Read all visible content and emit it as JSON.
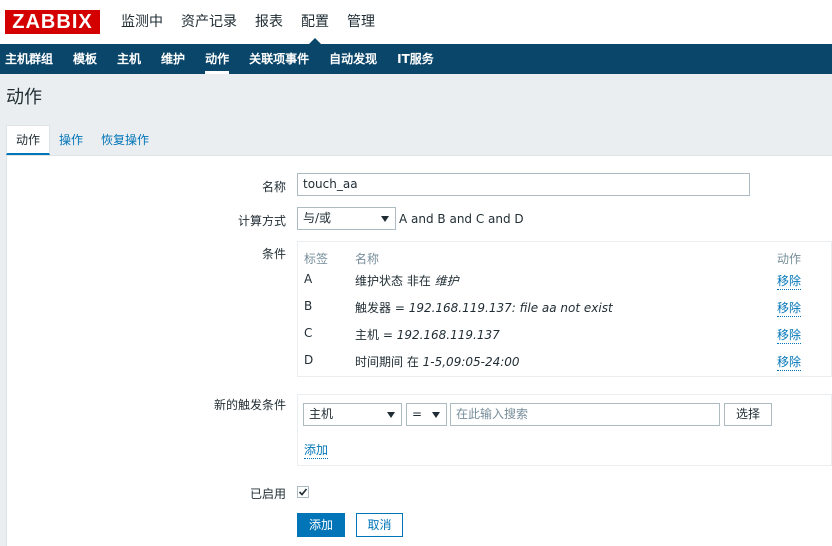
{
  "header": {
    "logo_text": "ZABBIX",
    "menu": [
      {
        "label": "监测中"
      },
      {
        "label": "资产记录"
      },
      {
        "label": "报表"
      },
      {
        "label": "配置"
      },
      {
        "label": "管理"
      }
    ]
  },
  "submenu": [
    {
      "label": "主机群组"
    },
    {
      "label": "模板"
    },
    {
      "label": "主机"
    },
    {
      "label": "维护"
    },
    {
      "label": "动作"
    },
    {
      "label": "关联项事件"
    },
    {
      "label": "自动发现"
    },
    {
      "label": "IT服务"
    }
  ],
  "page_title": "动作",
  "tabs": [
    {
      "label": "动作"
    },
    {
      "label": "操作"
    },
    {
      "label": "恢复操作"
    }
  ],
  "form": {
    "name_label": "名称",
    "name_value": "touch_aa",
    "calc_label": "计算方式",
    "calc_value": "与/或",
    "calc_formula": "A and B and C and D",
    "conditions_label": "条件",
    "conditions_headers": {
      "label": "标签",
      "name": "名称",
      "action": "动作"
    },
    "conditions": [
      {
        "label": "A",
        "prefix": "维护状态 非在 ",
        "value": "维护",
        "action": "移除"
      },
      {
        "label": "B",
        "prefix": "触发器 = ",
        "value": "192.168.119.137: file aa not exist",
        "action": "移除"
      },
      {
        "label": "C",
        "prefix": "主机 = ",
        "value": "192.168.119.137",
        "action": "移除"
      },
      {
        "label": "D",
        "prefix": "时间期间 在 ",
        "value": "1-5,09:05-24:00",
        "action": "移除"
      }
    ],
    "new_condition_label": "新的触发条件",
    "new_condition_type": "主机",
    "new_condition_op": "=",
    "new_condition_placeholder": "在此输入搜索",
    "select_button": "选择",
    "add_link": "添加",
    "enabled_label": "已启用",
    "add_button": "添加",
    "cancel_button": "取消"
  },
  "colors": {
    "brand_red": "#d40000",
    "nav_blue": "#0a466a",
    "link_blue": "#0275b8"
  }
}
